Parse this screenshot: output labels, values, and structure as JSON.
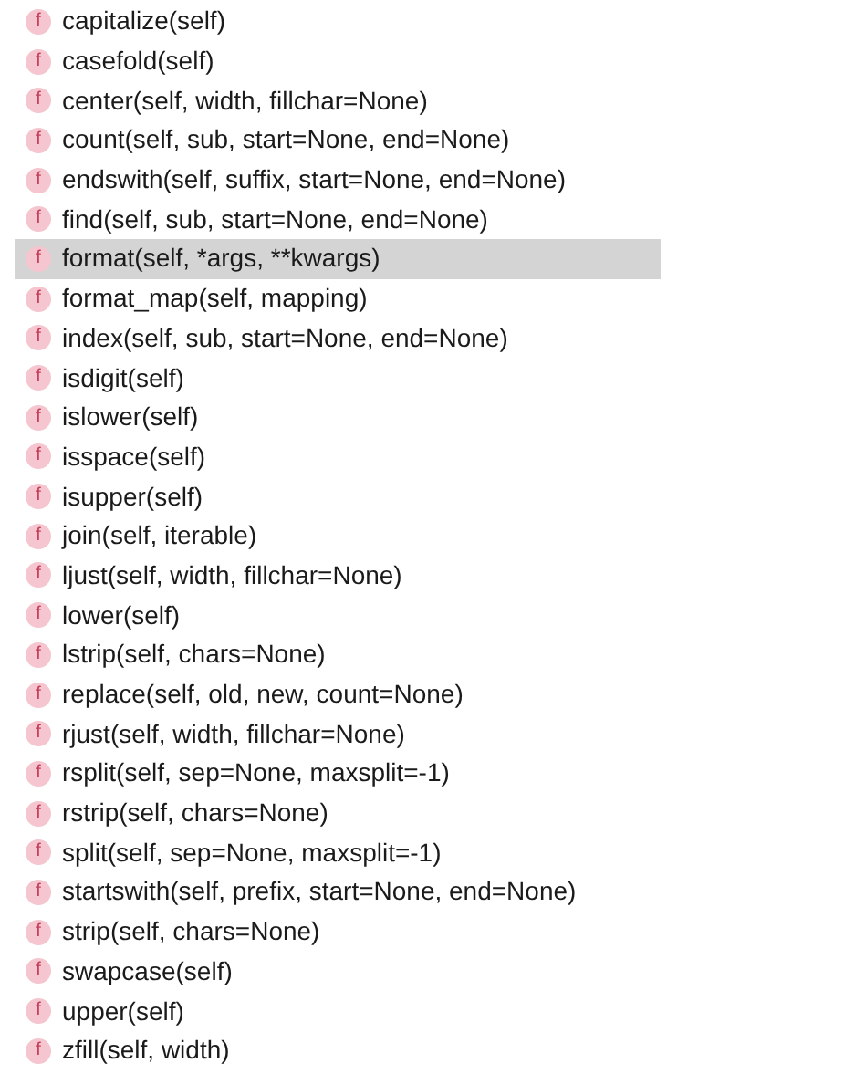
{
  "items": [
    {
      "icon": "f",
      "label": "capitalize(self)",
      "selected": false
    },
    {
      "icon": "f",
      "label": "casefold(self)",
      "selected": false
    },
    {
      "icon": "f",
      "label": "center(self, width, fillchar=None)",
      "selected": false
    },
    {
      "icon": "f",
      "label": "count(self, sub, start=None, end=None)",
      "selected": false
    },
    {
      "icon": "f",
      "label": "endswith(self, suffix, start=None, end=None)",
      "selected": false
    },
    {
      "icon": "f",
      "label": "find(self, sub, start=None, end=None)",
      "selected": false
    },
    {
      "icon": "f",
      "label": "format(self, *args, **kwargs)",
      "selected": true
    },
    {
      "icon": "f",
      "label": "format_map(self, mapping)",
      "selected": false
    },
    {
      "icon": "f",
      "label": "index(self, sub, start=None, end=None)",
      "selected": false
    },
    {
      "icon": "f",
      "label": "isdigit(self)",
      "selected": false
    },
    {
      "icon": "f",
      "label": "islower(self)",
      "selected": false
    },
    {
      "icon": "f",
      "label": "isspace(self)",
      "selected": false
    },
    {
      "icon": "f",
      "label": "isupper(self)",
      "selected": false
    },
    {
      "icon": "f",
      "label": "join(self, iterable)",
      "selected": false
    },
    {
      "icon": "f",
      "label": "ljust(self, width, fillchar=None)",
      "selected": false
    },
    {
      "icon": "f",
      "label": "lower(self)",
      "selected": false
    },
    {
      "icon": "f",
      "label": "lstrip(self, chars=None)",
      "selected": false
    },
    {
      "icon": "f",
      "label": "replace(self, old, new, count=None)",
      "selected": false
    },
    {
      "icon": "f",
      "label": "rjust(self, width, fillchar=None)",
      "selected": false
    },
    {
      "icon": "f",
      "label": "rsplit(self, sep=None, maxsplit=-1)",
      "selected": false
    },
    {
      "icon": "f",
      "label": "rstrip(self, chars=None)",
      "selected": false
    },
    {
      "icon": "f",
      "label": "split(self, sep=None, maxsplit=-1)",
      "selected": false
    },
    {
      "icon": "f",
      "label": "startswith(self, prefix, start=None, end=None)",
      "selected": false
    },
    {
      "icon": "f",
      "label": "strip(self, chars=None)",
      "selected": false
    },
    {
      "icon": "f",
      "label": "swapcase(self)",
      "selected": false
    },
    {
      "icon": "f",
      "label": "upper(self)",
      "selected": false
    },
    {
      "icon": "f",
      "label": "zfill(self, width)",
      "selected": false
    }
  ]
}
